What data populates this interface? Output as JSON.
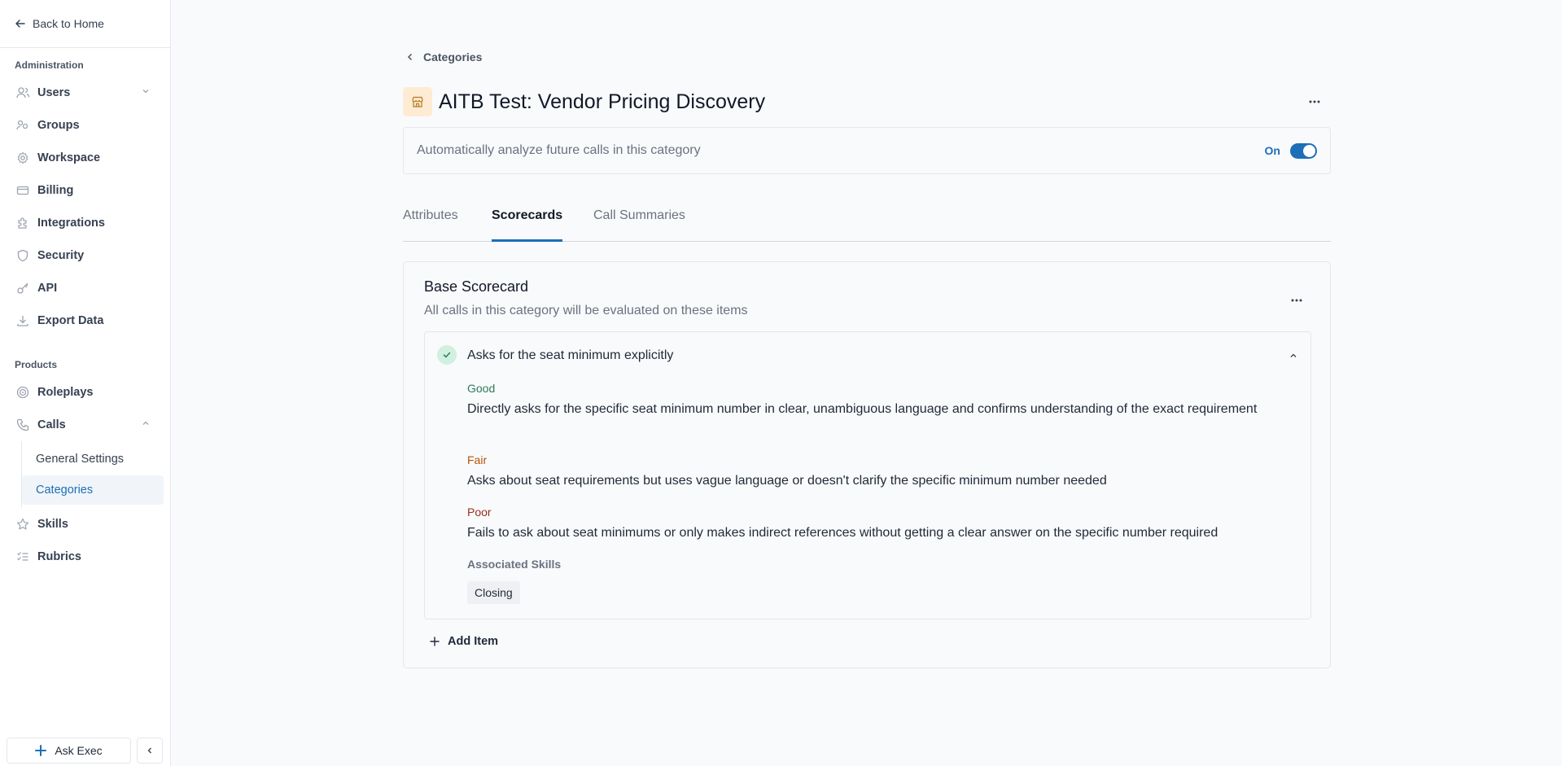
{
  "sidebar": {
    "back_label": "Back to Home",
    "admin_section": "Administration",
    "admin_items": [
      {
        "label": "Users",
        "icon": "users-icon"
      },
      {
        "label": "Groups",
        "icon": "groups-icon"
      },
      {
        "label": "Workspace",
        "icon": "gear-icon"
      },
      {
        "label": "Billing",
        "icon": "credit-card-icon"
      },
      {
        "label": "Integrations",
        "icon": "puzzle-icon"
      },
      {
        "label": "Security",
        "icon": "shield-icon"
      },
      {
        "label": "API",
        "icon": "key-icon"
      },
      {
        "label": "Export Data",
        "icon": "download-icon"
      }
    ],
    "products_section": "Products",
    "product_items": [
      {
        "label": "Roleplays",
        "icon": "target-icon"
      },
      {
        "label": "Calls",
        "icon": "phone-icon"
      }
    ],
    "calls_sub_items": [
      {
        "label": "General Settings",
        "active": false
      },
      {
        "label": "Categories",
        "active": true
      }
    ],
    "other_items": [
      {
        "label": "Skills",
        "icon": "star-icon"
      },
      {
        "label": "Rubrics",
        "icon": "list-check-icon"
      }
    ],
    "ask_exec_label": "Ask Exec"
  },
  "main": {
    "breadcrumb": "Categories",
    "title": "AITB Test: Vendor Pricing Discovery",
    "auto_analyze_text": "Automatically analyze future calls in this category",
    "toggle_label": "On",
    "toggle_on": true,
    "tabs": [
      {
        "label": "Attributes",
        "active": false
      },
      {
        "label": "Scorecards",
        "active": true
      },
      {
        "label": "Call Summaries",
        "active": false
      }
    ],
    "scorecard": {
      "title": "Base Scorecard",
      "subtitle": "All calls in this category will be evaluated on these items",
      "item": {
        "title": "Asks for the seat minimum explicitly",
        "good_label": "Good",
        "good_text": "Directly asks for the specific seat minimum number in clear, unambiguous language and confirms understanding of the exact requirement",
        "fair_label": "Fair",
        "fair_text": "Asks about seat requirements but uses vague language or doesn't clarify the specific minimum number needed",
        "poor_label": "Poor",
        "poor_text": "Fails to ask about seat minimums or only makes indirect references without getting a clear answer on the specific number required",
        "assoc_label": "Associated Skills",
        "skills": [
          "Closing"
        ]
      },
      "add_item_label": "Add Item"
    }
  },
  "colors": {
    "accent": "#1d6fb8",
    "good": "#2f7a5a",
    "fair": "#b45309",
    "poor": "#9a2d1a"
  }
}
